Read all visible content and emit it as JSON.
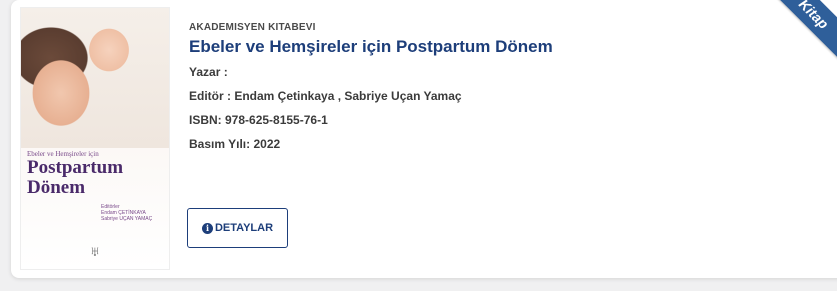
{
  "card": {
    "publisher": "AKADEMISYEN KITABEVI",
    "title": "Ebeler ve Hemşireler için Postpartum Dönem",
    "author_label": "Yazar :",
    "editor_line": "Editör : Endam Çetinkaya , Sabriye Uçan Yamaç",
    "isbn_line": "ISBN: 978-625-8155-76-1",
    "year_line": "Basım Yılı: 2022",
    "details_button": "DETAYLAR",
    "ribbon": "Kitap"
  },
  "cover": {
    "subtitle": "Ebeler ve Hemşireler için",
    "title_line1": "Postpartum",
    "title_line2": "Dönem",
    "editors_label": "Editörler",
    "editor1": "Endam ÇETİNKAYA",
    "editor2": "Sabriye UÇAN YAMAÇ"
  },
  "colors": {
    "accent": "#1d3e7a",
    "ribbon": "#2f5f9a",
    "background": "#f0f0f1"
  }
}
